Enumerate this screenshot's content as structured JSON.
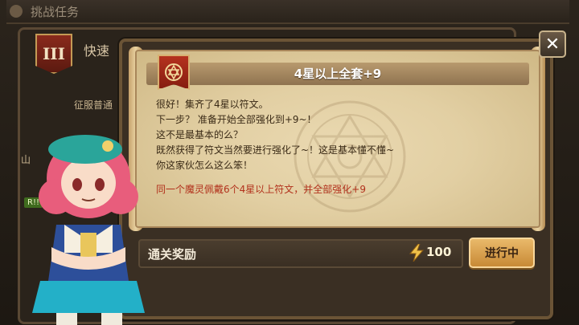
{
  "header": {
    "title": "挑战任务"
  },
  "background": {
    "tab_roman": "III",
    "quick_label": "快速",
    "conquer_label": "征服普通",
    "left_small": "山",
    "left_tag": "R!!"
  },
  "dialog": {
    "title": "4星以上全套+9",
    "lines": [
      "很好！集齐了4星以符文。",
      "下一步？ 准备开始全部强化到+9~！",
      "这不是最基本的么？",
      "既然获得了符文当然要进行强化了~！这是基本懂不懂~",
      "你这家伙怎么这么笨！"
    ],
    "requirement": "同一个魔灵佩戴6个4星以上符文，并全部强化+9",
    "reward_label": "通关奖励",
    "reward_value": "100",
    "status_button": "进行中",
    "close_icon": "close-icon"
  },
  "colors": {
    "accent": "#c88a36",
    "parchment": "#e2cfa3",
    "requirement_red": "#b2311c"
  }
}
